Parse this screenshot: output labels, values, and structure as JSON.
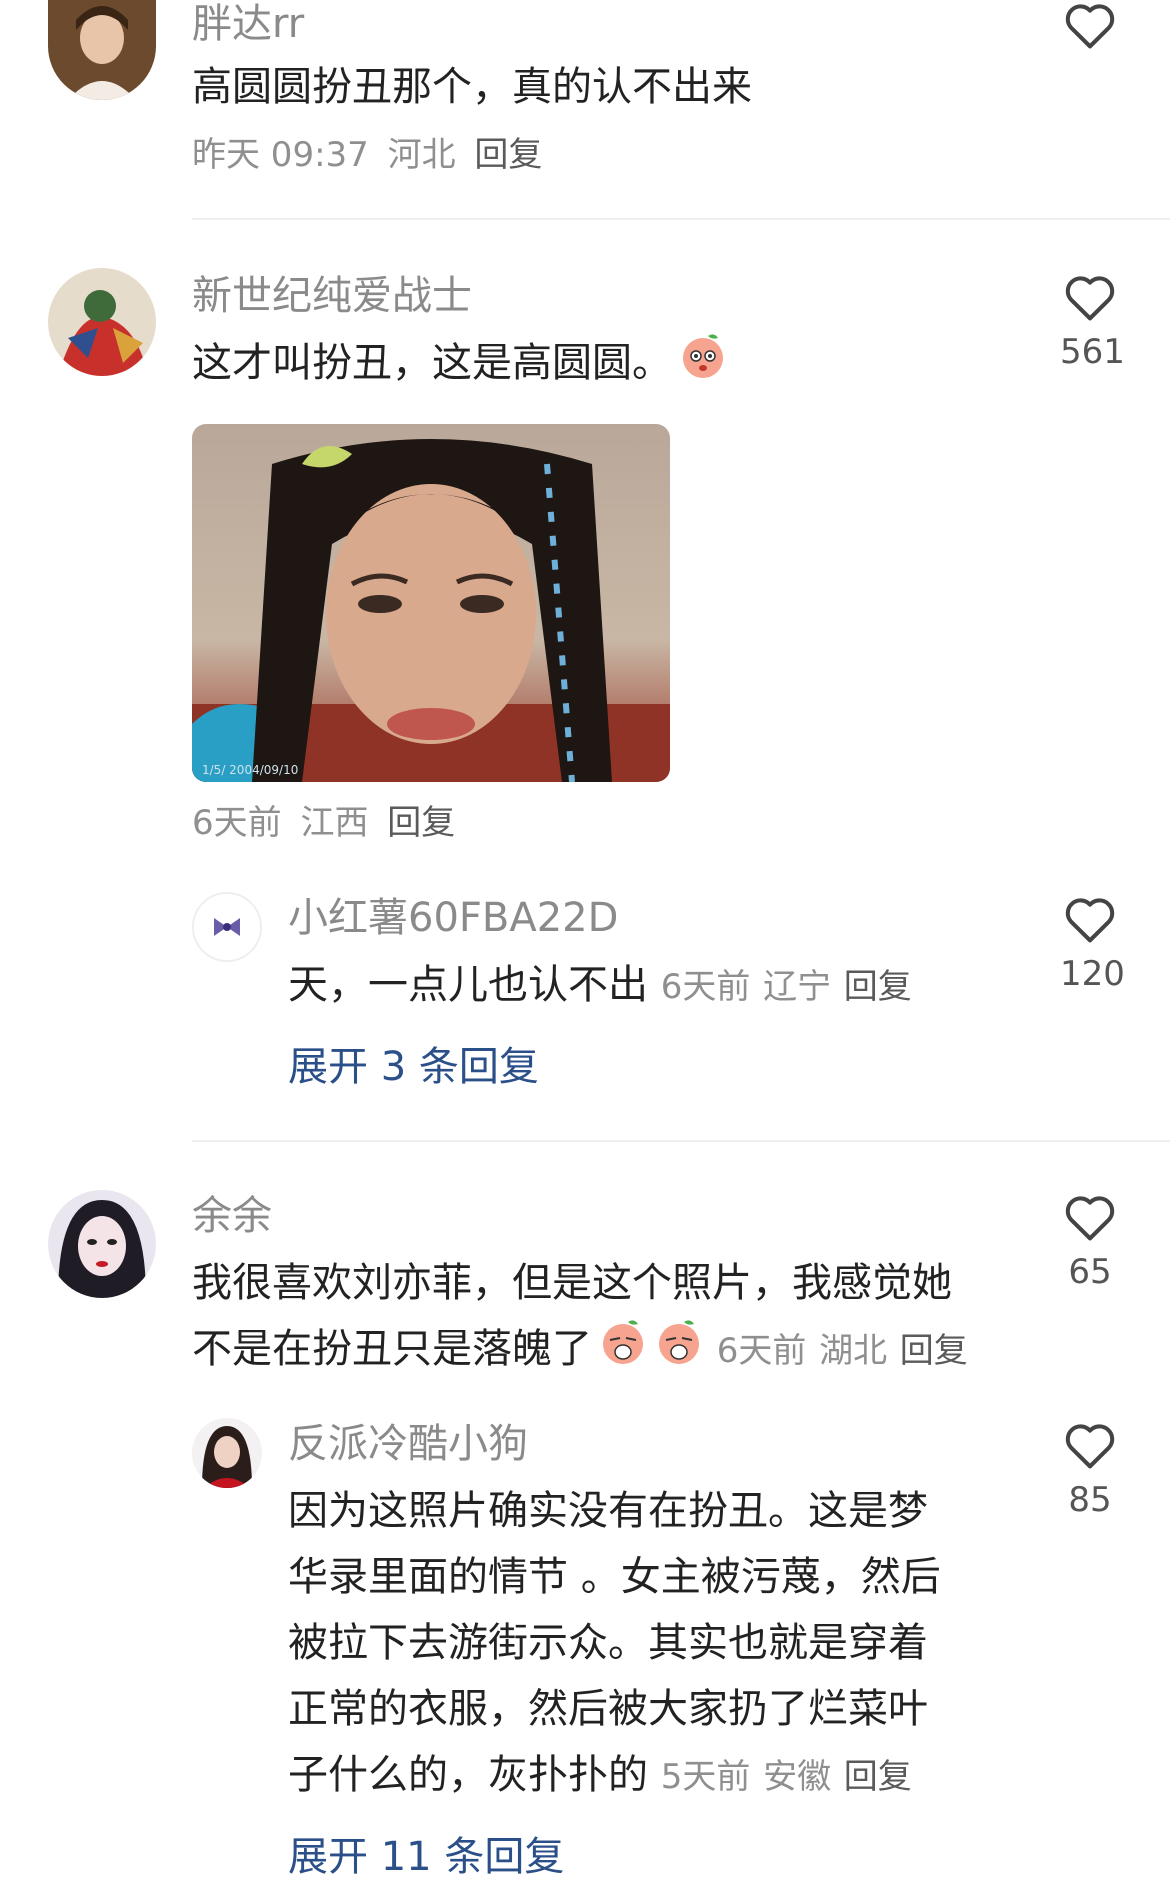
{
  "comments": [
    {
      "username": "胖达rr",
      "text": "高圆圆扮丑那个，真的认不出来",
      "time": "昨天 09:37",
      "location": "河北",
      "reply": "回复",
      "likes": ""
    },
    {
      "username": "新世纪纯爱战士",
      "text": "这才叫扮丑，这是高圆圆。",
      "time": "6天前",
      "location": "江西",
      "reply": "回复",
      "likes": "561",
      "image_watermark": "1/5/ 2004/09/10",
      "sub_reply": {
        "username": "小红薯60FBA22D",
        "text": "天，一点儿也认不出",
        "time": "6天前",
        "location": "辽宁",
        "reply": "回复",
        "likes": "120"
      },
      "expand": "展开 3 条回复"
    },
    {
      "username": "余余",
      "text_line1": "我很喜欢刘亦菲，但是这个照片，我感觉她",
      "text_line2": "不是在扮丑只是落魄了",
      "time": "6天前",
      "location": "湖北",
      "reply": "回复",
      "likes": "65",
      "sub_reply": {
        "username": "反派冷酷小狗",
        "lines": [
          "因为这照片确实没有在扮丑。这是梦",
          "华录里面的情节 。女主被污蔑，然后",
          "被拉下去游街示众。其实也就是穿着",
          "正常的衣服，然后被大家扔了烂菜叶",
          "子什么的，灰扑扑的"
        ],
        "time": "5天前",
        "location": "安徽",
        "reply": "回复",
        "likes": "85"
      },
      "expand": "展开 11 条回复"
    }
  ],
  "icons": {
    "like": "heart-outline-icon",
    "emoji": "peach-face-emoji"
  },
  "colors": {
    "username": "#8a8a8a",
    "text": "#222222",
    "meta": "#8f8f8f",
    "expand": "#2b4f89",
    "heart_stroke": "#444444"
  }
}
